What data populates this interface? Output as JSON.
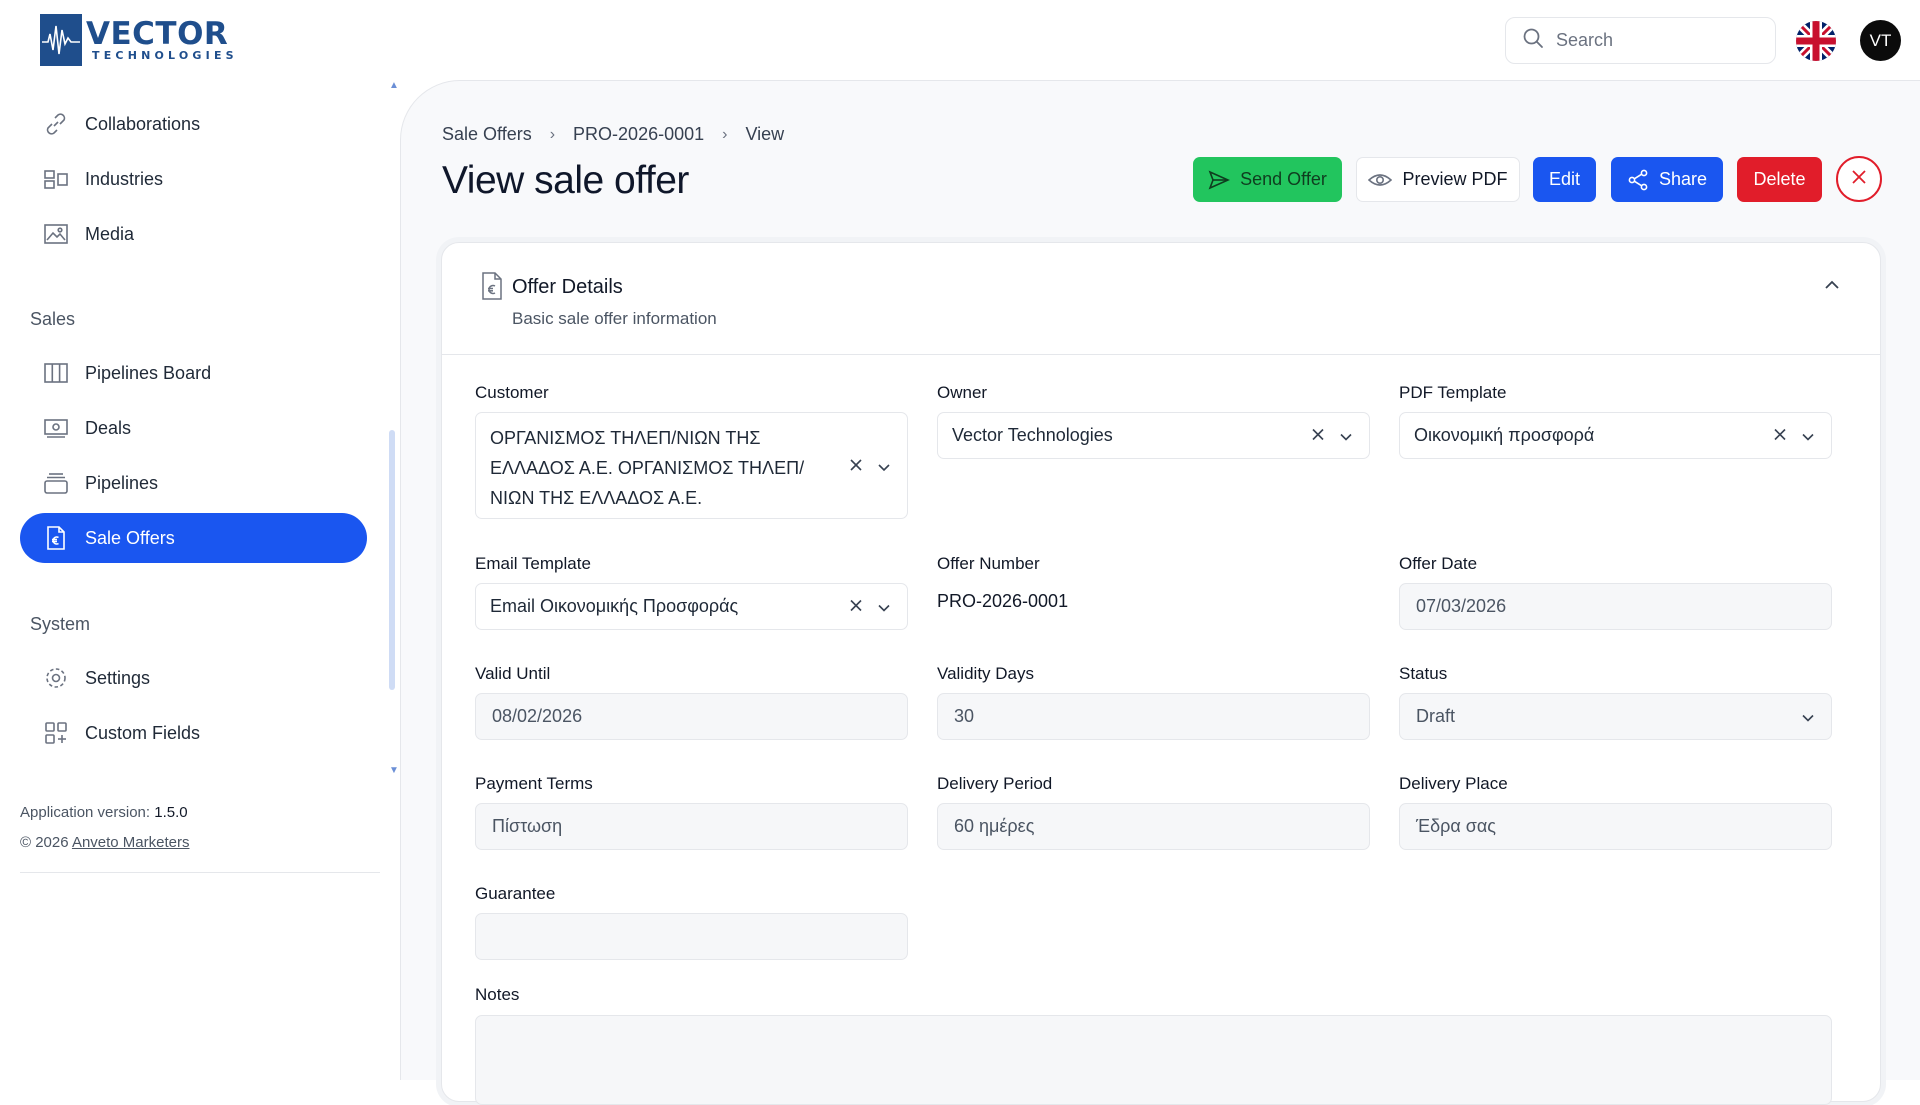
{
  "brand": {
    "name": "VECTOR",
    "tagline": "TECHNOLOGIES"
  },
  "topbar": {
    "search_placeholder": "Search",
    "avatar_initials": "VT",
    "language": "English (UK)"
  },
  "sidebar": {
    "top_items": [
      {
        "label": "Collaborations",
        "icon": "link-icon"
      },
      {
        "label": "Industries",
        "icon": "layout-icon"
      },
      {
        "label": "Media",
        "icon": "image-icon"
      }
    ],
    "sales_section": "Sales",
    "sales_items": [
      {
        "label": "Pipelines Board",
        "icon": "columns-icon"
      },
      {
        "label": "Deals",
        "icon": "money-icon"
      },
      {
        "label": "Pipelines",
        "icon": "stack-icon"
      },
      {
        "label": "Sale Offers",
        "icon": "euro-document-icon",
        "active": true
      }
    ],
    "system_section": "System",
    "system_items": [
      {
        "label": "Settings",
        "icon": "gear-icon"
      },
      {
        "label": "Custom Fields",
        "icon": "grid-plus-icon"
      }
    ],
    "footer": {
      "version_label": "Application version:",
      "version": "1.5.0",
      "copyright": "© 2026",
      "company_link": "Anveto Marketers"
    }
  },
  "breadcrumb": [
    "Sale Offers",
    "PRO-2026-0001",
    "View"
  ],
  "page_title": "View sale offer",
  "actions": {
    "send": "Send Offer",
    "preview": "Preview PDF",
    "edit": "Edit",
    "share": "Share",
    "delete": "Delete"
  },
  "colors": {
    "primary": "#1a56f0",
    "success": "#22c55e",
    "danger": "#e11d2a"
  },
  "card": {
    "title": "Offer Details",
    "subtitle": "Basic sale offer information"
  },
  "fields": {
    "customer": {
      "label": "Customer",
      "value": "ΟΡΓΑΝΙΣΜΟΣ ΤΗΛΕΠ/ΝΙΩΝ ΤΗΣ ΕΛΛΑΔΟΣ Α.Ε. ΟΡΓΑΝΙΣΜΟΣ ΤΗΛΕΠ/ΝΙΩΝ ΤΗΣ ΕΛΛΑΔΟΣ Α.Ε."
    },
    "owner": {
      "label": "Owner",
      "value": "Vector Technologies"
    },
    "pdf_template": {
      "label": "PDF Template",
      "value": "Οικονομική προσφορά"
    },
    "email_template": {
      "label": "Email Template",
      "value": "Email Οικονομικής Προσφοράς"
    },
    "offer_number": {
      "label": "Offer Number",
      "value": "PRO-2026-0001"
    },
    "offer_date": {
      "label": "Offer Date",
      "value": "07/03/2026"
    },
    "valid_until": {
      "label": "Valid Until",
      "value": "08/02/2026"
    },
    "validity_days": {
      "label": "Validity Days",
      "value": "30"
    },
    "status": {
      "label": "Status",
      "value": "Draft"
    },
    "payment_terms": {
      "label": "Payment Terms",
      "value": "Πίστωση"
    },
    "delivery_period": {
      "label": "Delivery Period",
      "value": "60 ημέρες"
    },
    "delivery_place": {
      "label": "Delivery Place",
      "value": "Έδρα σας"
    },
    "guarantee": {
      "label": "Guarantee",
      "value": ""
    },
    "notes": {
      "label": "Notes",
      "value": ""
    }
  }
}
